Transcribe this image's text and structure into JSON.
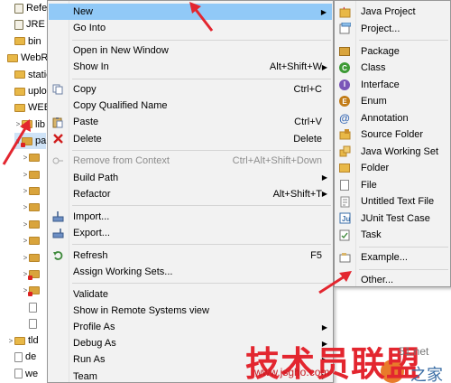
{
  "tree": {
    "items": [
      {
        "label": "Referenc",
        "indent": 1,
        "toggle": "",
        "icon": "jar"
      },
      {
        "label": "JRE Syste",
        "indent": 1,
        "toggle": "",
        "icon": "jar"
      },
      {
        "label": "bin",
        "indent": 1,
        "toggle": "",
        "icon": "folder"
      },
      {
        "label": "WebRoot",
        "indent": 0,
        "toggle": "",
        "icon": "folder"
      },
      {
        "label": "static",
        "indent": 1,
        "toggle": "",
        "icon": "folder"
      },
      {
        "label": "uploa",
        "indent": 1,
        "toggle": "",
        "icon": "folder"
      },
      {
        "label": "WEB-I",
        "indent": 1,
        "toggle": "",
        "icon": "folder"
      },
      {
        "label": "lib",
        "indent": 2,
        "toggle": ">",
        "icon": "folder"
      },
      {
        "label": "pa",
        "indent": 2,
        "toggle": "v",
        "icon": "pkg-err"
      },
      {
        "label": "",
        "indent": 3,
        "toggle": ">",
        "icon": "pkg"
      },
      {
        "label": "",
        "indent": 3,
        "toggle": ">",
        "icon": "pkg"
      },
      {
        "label": "",
        "indent": 3,
        "toggle": ">",
        "icon": "pkg"
      },
      {
        "label": "",
        "indent": 3,
        "toggle": ">",
        "icon": "pkg"
      },
      {
        "label": "",
        "indent": 3,
        "toggle": ">",
        "icon": "pkg"
      },
      {
        "label": "",
        "indent": 3,
        "toggle": ">",
        "icon": "pkg"
      },
      {
        "label": "",
        "indent": 3,
        "toggle": ">",
        "icon": "pkg"
      },
      {
        "label": "",
        "indent": 3,
        "toggle": ">",
        "icon": "pkg-err"
      },
      {
        "label": "",
        "indent": 3,
        "toggle": ">",
        "icon": "pkg-err"
      },
      {
        "label": "",
        "indent": 3,
        "toggle": "",
        "icon": "file"
      },
      {
        "label": "",
        "indent": 3,
        "toggle": "",
        "icon": "file"
      },
      {
        "label": "tld",
        "indent": 1,
        "toggle": ">",
        "icon": "folder"
      },
      {
        "label": "de",
        "indent": 1,
        "toggle": "",
        "icon": "file"
      },
      {
        "label": "we",
        "indent": 1,
        "toggle": "",
        "icon": "file"
      }
    ]
  },
  "menu": {
    "items": [
      {
        "type": "item",
        "label": "New",
        "shortcut": "",
        "submenu": true,
        "highlight": true,
        "icon": ""
      },
      {
        "type": "item",
        "label": "Go Into",
        "shortcut": "",
        "icon": ""
      },
      {
        "type": "sep"
      },
      {
        "type": "item",
        "label": "Open in New Window",
        "shortcut": "",
        "icon": ""
      },
      {
        "type": "item",
        "label": "Show In",
        "shortcut": "Alt+Shift+W",
        "submenu": true,
        "icon": ""
      },
      {
        "type": "sep"
      },
      {
        "type": "item",
        "label": "Copy",
        "shortcut": "Ctrl+C",
        "icon": "copy-icon"
      },
      {
        "type": "item",
        "label": "Copy Qualified Name",
        "shortcut": "",
        "icon": ""
      },
      {
        "type": "item",
        "label": "Paste",
        "shortcut": "Ctrl+V",
        "icon": "paste-icon"
      },
      {
        "type": "item",
        "label": "Delete",
        "shortcut": "Delete",
        "icon": "delete-icon"
      },
      {
        "type": "sep"
      },
      {
        "type": "item",
        "label": "Remove from Context",
        "shortcut": "Ctrl+Alt+Shift+Down",
        "disabled": true,
        "icon": "remove-context-icon"
      },
      {
        "type": "item",
        "label": "Build Path",
        "shortcut": "",
        "submenu": true,
        "icon": ""
      },
      {
        "type": "item",
        "label": "Refactor",
        "shortcut": "Alt+Shift+T",
        "submenu": true,
        "icon": ""
      },
      {
        "type": "sep"
      },
      {
        "type": "item",
        "label": "Import...",
        "shortcut": "",
        "icon": "import-icon"
      },
      {
        "type": "item",
        "label": "Export...",
        "shortcut": "",
        "icon": "export-icon"
      },
      {
        "type": "sep"
      },
      {
        "type": "item",
        "label": "Refresh",
        "shortcut": "F5",
        "icon": "refresh-icon"
      },
      {
        "type": "item",
        "label": "Assign Working Sets...",
        "shortcut": "",
        "icon": ""
      },
      {
        "type": "sep"
      },
      {
        "type": "item",
        "label": "Validate",
        "shortcut": "",
        "icon": ""
      },
      {
        "type": "item",
        "label": "Show in Remote Systems view",
        "shortcut": "",
        "icon": ""
      },
      {
        "type": "item",
        "label": "Profile As",
        "shortcut": "",
        "submenu": true,
        "icon": ""
      },
      {
        "type": "item",
        "label": "Debug As",
        "shortcut": "",
        "submenu": true,
        "icon": ""
      },
      {
        "type": "item",
        "label": "Run As",
        "shortcut": "",
        "submenu": true,
        "icon": ""
      },
      {
        "type": "item",
        "label": "Team",
        "shortcut": "",
        "submenu": true,
        "icon": ""
      }
    ]
  },
  "submenu": {
    "items": [
      {
        "type": "item",
        "label": "Java Project",
        "icon": "java-project-icon"
      },
      {
        "type": "item",
        "label": "Project...",
        "icon": "project-icon"
      },
      {
        "type": "sep"
      },
      {
        "type": "item",
        "label": "Package",
        "icon": "package-icon"
      },
      {
        "type": "item",
        "label": "Class",
        "icon": "class-icon"
      },
      {
        "type": "item",
        "label": "Interface",
        "icon": "interface-icon"
      },
      {
        "type": "item",
        "label": "Enum",
        "icon": "enum-icon"
      },
      {
        "type": "item",
        "label": "Annotation",
        "icon": "annotation-icon"
      },
      {
        "type": "item",
        "label": "Source Folder",
        "icon": "source-folder-icon"
      },
      {
        "type": "item",
        "label": "Java Working Set",
        "icon": "working-set-icon"
      },
      {
        "type": "item",
        "label": "Folder",
        "icon": "folder-icon"
      },
      {
        "type": "item",
        "label": "File",
        "icon": "file-icon"
      },
      {
        "type": "item",
        "label": "Untitled Text File",
        "icon": "text-file-icon"
      },
      {
        "type": "item",
        "label": "JUnit Test Case",
        "icon": "junit-icon"
      },
      {
        "type": "item",
        "label": "Task",
        "icon": "task-icon"
      },
      {
        "type": "sep"
      },
      {
        "type": "item",
        "label": "Example...",
        "icon": "example-icon"
      },
      {
        "type": "sep"
      },
      {
        "type": "item",
        "label": "Other...",
        "icon": "other-icon"
      }
    ]
  },
  "watermark": {
    "brand": "技术员联盟",
    "url": "www.jsgho.com",
    "side_text": "51.net",
    "side_cn": "之家"
  },
  "colors": {
    "highlight": "#91c9f7",
    "menu_bg": "#f2f2f2",
    "annotation_arrow": "#e3262f"
  }
}
